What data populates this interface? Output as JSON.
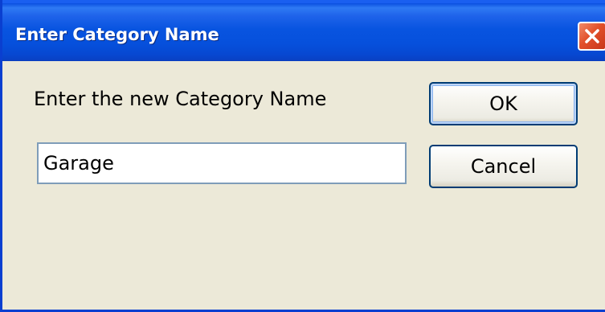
{
  "window": {
    "title": "Enter Category Name",
    "close_icon": "close-icon"
  },
  "dialog": {
    "prompt": "Enter the new Category Name",
    "input_value": "Garage",
    "ok_label": "OK",
    "cancel_label": "Cancel"
  },
  "colors": {
    "titlebar": "#0854e0",
    "close_button": "#e2502a",
    "client_background": "#ece9d8",
    "input_border": "#7f9db9",
    "button_border": "#003c74"
  }
}
